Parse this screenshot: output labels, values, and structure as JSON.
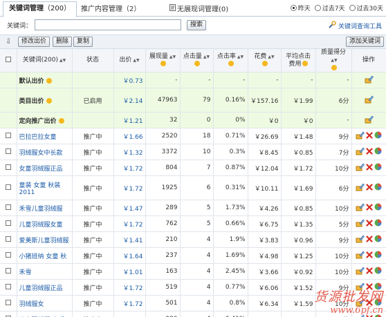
{
  "tabs": [
    {
      "label": "关键词管理",
      "count": "（200）"
    },
    {
      "label": "推广内容管理",
      "count": "（2）"
    },
    {
      "label": "无展现词管理",
      "count": "(0)"
    }
  ],
  "date_range": {
    "options": [
      "昨天",
      "过去7天",
      "过去30天"
    ],
    "selected": "昨天"
  },
  "search": {
    "label": "关键词：",
    "value": "",
    "placeholder": "",
    "button": "搜索",
    "tool_link": "关键词查询工具"
  },
  "toolbar": {
    "modify_price": "修改出价",
    "delete": "删除",
    "copy": "复制",
    "add": "添加关键词"
  },
  "columns": {
    "keyword": "关键词(200)",
    "status": "状态",
    "price": "出价",
    "impressions": "展现量",
    "clicks": "点击量",
    "ctr": "点击率",
    "cost": "花费",
    "avg_cost": "平均点击费用",
    "quality": "质量得分",
    "action": "操作"
  },
  "system_rows": [
    {
      "name": "默认出价",
      "status": "",
      "price": "￥0.73",
      "impressions": "-",
      "clicks": "-",
      "ctr": "-",
      "cost": "-",
      "avg_cost": "-",
      "quality": "-"
    },
    {
      "name": "类目出价",
      "status": "已启用",
      "price": "￥2.14",
      "impressions": "47963",
      "clicks": "79",
      "ctr": "0.16%",
      "cost": "￥157.16",
      "avg_cost": "￥1.99",
      "quality": "6分"
    },
    {
      "name": "定向推广出价",
      "status": "",
      "price": "￥1.21",
      "impressions": "32",
      "clicks": "0",
      "ctr": "0%",
      "cost": "￥0",
      "avg_cost": "￥0",
      "quality": "-"
    }
  ],
  "rows": [
    {
      "keyword": "巴拉巴拉女童",
      "status": "推广中",
      "price": "￥1.66",
      "impressions": "2520",
      "clicks": "18",
      "ctr": "0.71%",
      "cost": "￥26.69",
      "avg_cost": "￥1.48",
      "quality": "9分"
    },
    {
      "keyword": "羽绒服女中长款",
      "status": "推广中",
      "price": "￥1.32",
      "impressions": "3372",
      "clicks": "10",
      "ctr": "0.3%",
      "cost": "￥8.45",
      "avg_cost": "￥0.85",
      "quality": "7分"
    },
    {
      "keyword": "女童羽绒服正品",
      "status": "推广中",
      "price": "￥1.72",
      "impressions": "804",
      "clicks": "7",
      "ctr": "0.87%",
      "cost": "￥12.04",
      "avg_cost": "￥1.72",
      "quality": "10分"
    },
    {
      "keyword": "童装 女童 秋装 2011",
      "status": "推广中",
      "price": "￥1.72",
      "impressions": "1925",
      "clicks": "6",
      "ctr": "0.31%",
      "cost": "￥10.11",
      "avg_cost": "￥1.69",
      "quality": "6分",
      "tall": true
    },
    {
      "keyword": "禾雪儿童羽绒服",
      "status": "推广中",
      "price": "￥1.47",
      "impressions": "289",
      "clicks": "5",
      "ctr": "1.73%",
      "cost": "￥4.26",
      "avg_cost": "￥0.85",
      "quality": "10分"
    },
    {
      "keyword": "儿童羽绒服女童",
      "status": "推广中",
      "price": "￥1.72",
      "impressions": "762",
      "clicks": "5",
      "ctr": "0.66%",
      "cost": "￥6.75",
      "avg_cost": "￥1.35",
      "quality": "5分"
    },
    {
      "keyword": "爱美斯儿童羽绒服",
      "status": "推广中",
      "price": "￥1.41",
      "impressions": "210",
      "clicks": "4",
      "ctr": "1.9%",
      "cost": "￥3.83",
      "avg_cost": "￥0.96",
      "quality": "9分"
    },
    {
      "keyword": "小猪班纳 女童 秋",
      "status": "推广中",
      "price": "￥1.64",
      "impressions": "237",
      "clicks": "4",
      "ctr": "1.69%",
      "cost": "￥4.98",
      "avg_cost": "￥1.25",
      "quality": "10分"
    },
    {
      "keyword": "禾雪",
      "status": "推广中",
      "price": "￥1.01",
      "impressions": "163",
      "clicks": "4",
      "ctr": "2.45%",
      "cost": "￥3.66",
      "avg_cost": "￥0.92",
      "quality": "10分"
    },
    {
      "keyword": "儿童羽绒服正品",
      "status": "推广中",
      "price": "￥1.72",
      "impressions": "519",
      "clicks": "4",
      "ctr": "0.77%",
      "cost": "￥6.06",
      "avg_cost": "￥1.52",
      "quality": "9分"
    },
    {
      "keyword": "羽绒服女",
      "status": "推广中",
      "price": "￥1.72",
      "impressions": "501",
      "clicks": "4",
      "ctr": "0.8%",
      "cost": "￥6.34",
      "avg_cost": "￥1.59",
      "quality": "10分"
    },
    {
      "keyword": "儿童羽绒服 韦氏",
      "status": "推广中",
      "price": "￥1.72",
      "impressions": "980",
      "clicks": "4",
      "ctr": "0.41%",
      "cost": "￥6.47",
      "avg_cost": "￥1.62",
      "quality": "5分"
    }
  ],
  "watermark": {
    "line1": "货源批发网",
    "line2": "www.6pf.cn"
  },
  "colors": {
    "link": "#1a5aa6",
    "system_row_bg": "#eefbe2",
    "header_bg": "#f3f5f8",
    "help_icon": "#f5b81e"
  }
}
